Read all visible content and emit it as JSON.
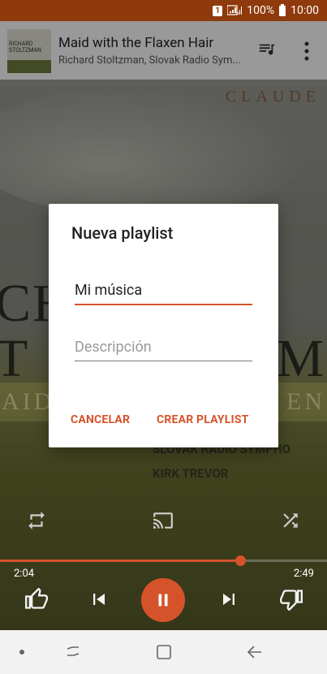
{
  "status_bar": {
    "sim_label": "1",
    "battery_percent": "100%",
    "time": "10:00"
  },
  "now_playing": {
    "title": "Maid with the Flaxen Hair",
    "artists": "Richard Stoltzman, Slovak Radio Sym...",
    "thumb_line1": "RICHARD",
    "thumb_line2": "STOLTZMAN",
    "queue_icon": "queue-music-icon",
    "more_icon": "more-vert-icon"
  },
  "album_art": {
    "brand": "CLAUDE",
    "text_line1": "CH",
    "text_line2": "T",
    "text_right": "M",
    "strip_left": "AID",
    "strip_right": "EN",
    "orchestra": "SLOVAK RADIO SYMPHO",
    "conductor": "KIRK TREVOR"
  },
  "dialog": {
    "title": "Nueva playlist",
    "name_value": "Mi música",
    "description_placeholder": "Descripción",
    "cancel_label": "CANCELAR",
    "create_label": "CREAR PLAYLIST"
  },
  "player": {
    "elapsed": "2:04",
    "duration": "2:49",
    "progress_fraction": 0.734,
    "accent_color": "#d5532a"
  },
  "controls": {
    "repeat_icon": "repeat-icon",
    "cast_icon": "cast-icon",
    "shuffle_icon": "shuffle-icon",
    "thumb_up_icon": "thumb-up-icon",
    "previous_icon": "skip-previous-icon",
    "pause_icon": "pause-icon",
    "next_icon": "skip-next-icon",
    "thumb_down_icon": "thumb-down-icon"
  },
  "navbar": {
    "dot_icon": "nav-dot-icon",
    "recents_icon": "recents-icon",
    "home_icon": "home-icon",
    "back_icon": "back-icon"
  }
}
